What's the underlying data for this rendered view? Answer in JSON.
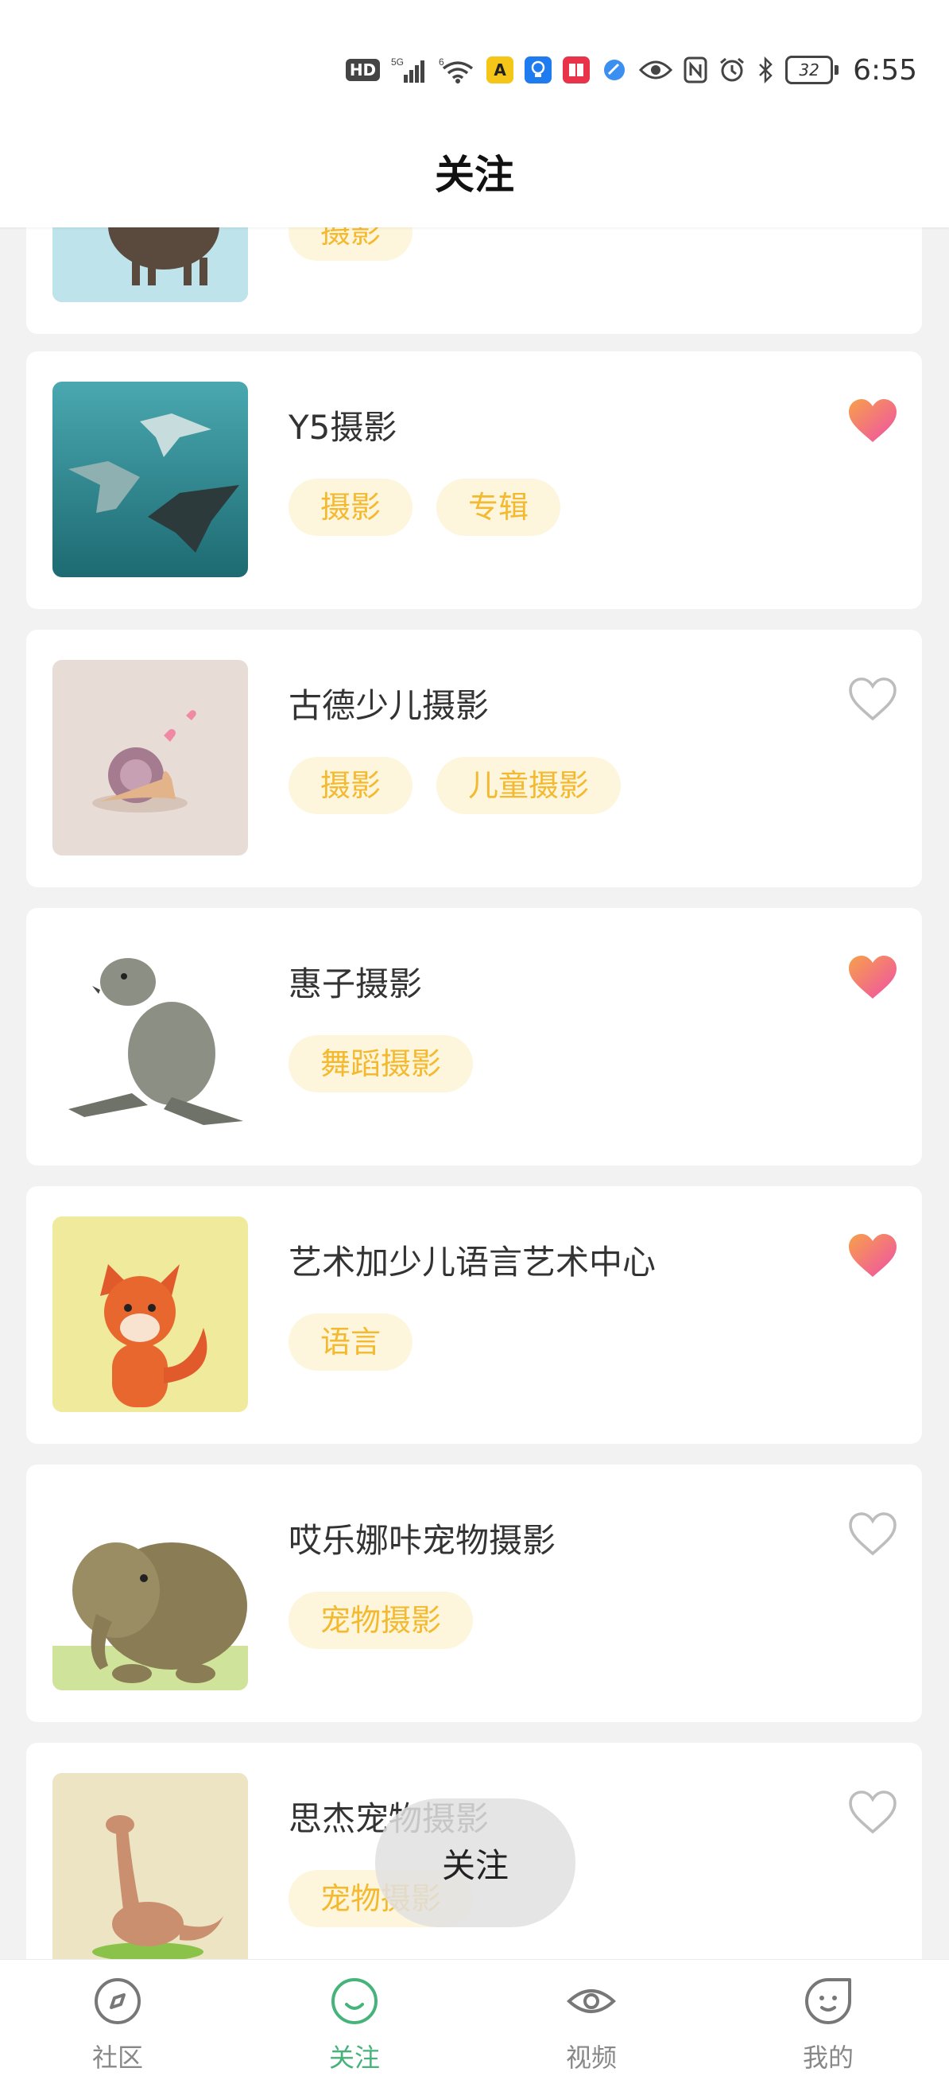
{
  "status_bar": {
    "hd": "HD",
    "network_5g": "5G",
    "network_6": "6",
    "battery": "32",
    "time": "6:55"
  },
  "header": {
    "title": "关注"
  },
  "items": [
    {
      "title": "",
      "tags": [
        "摄影"
      ],
      "liked": false,
      "thumb": "sheep-icon"
    },
    {
      "title": "Y5摄影",
      "tags": [
        "摄影",
        "专辑"
      ],
      "liked": true,
      "thumb": "stingray-icon"
    },
    {
      "title": "古德少儿摄影",
      "tags": [
        "摄影",
        "儿童摄影"
      ],
      "liked": false,
      "thumb": "snail-icon"
    },
    {
      "title": "惠子摄影",
      "tags": [
        "舞蹈摄影"
      ],
      "liked": true,
      "thumb": "seal-icon"
    },
    {
      "title": "艺术加少儿语言艺术中心",
      "tags": [
        "语言"
      ],
      "liked": true,
      "thumb": "fox-icon"
    },
    {
      "title": "哎乐娜咔宠物摄影",
      "tags": [
        "宠物摄影"
      ],
      "liked": false,
      "thumb": "elephant-icon"
    },
    {
      "title": "思杰宠物摄影",
      "tags": [
        "宠物摄影"
      ],
      "liked": false,
      "thumb": "dinosaur-icon"
    }
  ],
  "toast": {
    "text": "关注"
  },
  "nav": [
    {
      "label": "社区",
      "icon": "compass-icon",
      "active": false
    },
    {
      "label": "关注",
      "icon": "smile-icon",
      "active": true
    },
    {
      "label": "视频",
      "icon": "eye-icon",
      "active": false
    },
    {
      "label": "我的",
      "icon": "face-icon",
      "active": false
    }
  ],
  "colors": {
    "accent": "#46b37b",
    "tag_bg": "#fdf5dc",
    "tag_text": "#f4b92e",
    "heart_liked_start": "#f7a04a",
    "heart_liked_end": "#ef4fa8"
  }
}
